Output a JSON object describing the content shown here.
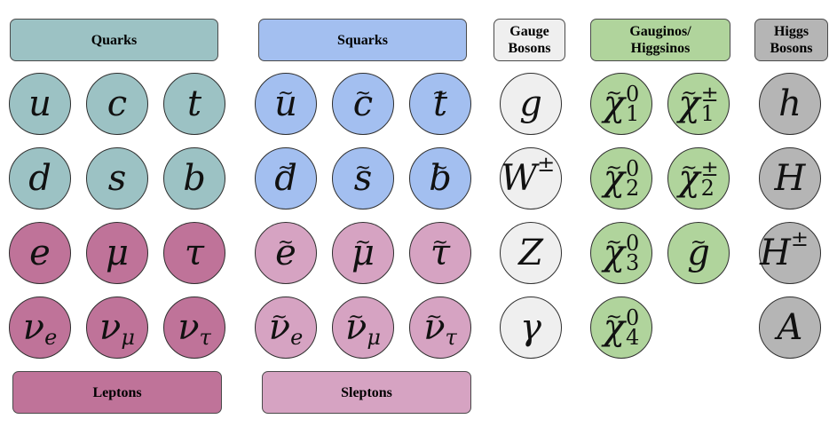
{
  "colors": {
    "quark": "#9cc2c4",
    "squark": "#a3bff0",
    "lepton": "#bf7399",
    "slepton": "#d6a3c2",
    "gauge": "#efefef",
    "gaugino": "#b0d49c",
    "higgs": "#b5b5b5"
  },
  "headers": {
    "quarks": "Quarks",
    "squarks": "Squarks",
    "gauge_l1": "Gauge",
    "gauge_l2": "Bosons",
    "gaugino_l1": "Gauginos/",
    "gaugino_l2": "Higgsinos",
    "higgs_l1": "Higgs",
    "higgs_l2": "Bosons",
    "leptons": "Leptons",
    "sleptons": "Sleptons"
  },
  "particles": {
    "quarks": [
      "u",
      "c",
      "t",
      "d",
      "s",
      "b"
    ],
    "squarks": [
      "u",
      "c",
      "t",
      "d",
      "s",
      "b"
    ],
    "leptons": [
      "e",
      "μ",
      "τ",
      "ν",
      "ν",
      "ν"
    ],
    "lepton_subs": [
      "e",
      "μ",
      "τ"
    ],
    "sleptons": [
      "e",
      "μ",
      "τ",
      "ν",
      "ν",
      "ν"
    ],
    "gauge": [
      "g",
      "W",
      "Z",
      "γ"
    ],
    "gauge_sup": "±",
    "chi": "χ",
    "neutralino_subs": [
      "1",
      "2",
      "3",
      "4"
    ],
    "neutralino_sup": "0",
    "chargino_subs": [
      "1",
      "2"
    ],
    "chargino_sup": "±",
    "gluino": "g",
    "higgs": [
      "h",
      "H",
      "H",
      "A"
    ],
    "higgs_sup": "±"
  }
}
